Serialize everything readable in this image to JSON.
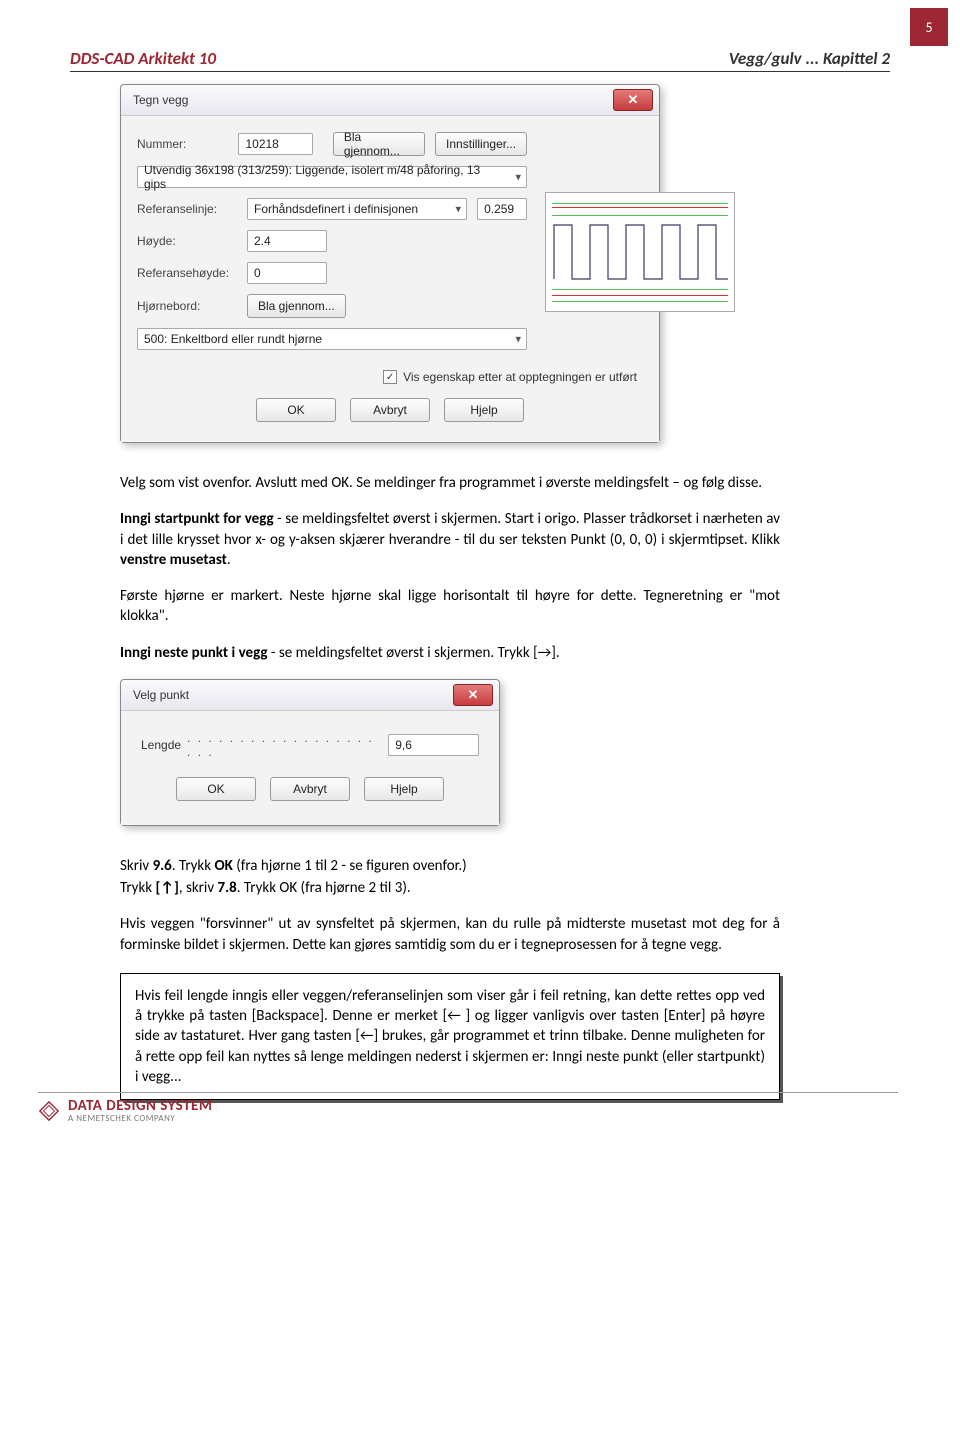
{
  "page_number": "5",
  "header": {
    "left": "DDS-CAD Arkitekt 10",
    "right": "Vegg/gulv ... Kapittel 2"
  },
  "dlg1": {
    "title": "Tegn vegg",
    "close": "✕",
    "nummer_label": "Nummer:",
    "nummer_value": "10218",
    "bla_gjennom": "Bla gjennom...",
    "innstillinger": "Innstillinger...",
    "type_value": "Utvendig 36x198 (313/259): Liggende, isolert m/48 påforing, 13 gips",
    "referanselinje_label": "Referanselinje:",
    "referanselinje_value": "Forhåndsdefinert i definisjonen",
    "referanselinje_num": "0.259",
    "hoyde_label": "Høyde:",
    "hoyde_value": "2.4",
    "refh_label": "Referansehøyde:",
    "refh_value": "0",
    "hjornebord_label": "Hjørnebord:",
    "hj_value": "500: Enkeltbord eller rundt hjørne",
    "check_label": "Vis egenskap etter at opptegningen er utført",
    "ok": "OK",
    "avbryt": "Avbryt",
    "hjelp": "Hjelp"
  },
  "p1": "Velg som vist ovenfor. Avslutt med OK. Se meldinger fra programmet i øverste meldingsfelt – og følg disse.",
  "p2a": "Inngi startpunkt for vegg",
  "p2b": " - se meldingsfeltet øverst i skjermen. Start i origo. Plasser trådkorset i nærheten av i det lille krysset hvor x- og y-aksen skjærer hverandre - til du ser teksten Punkt (0, 0, 0) i skjermtipset. Klikk ",
  "p2c": "venstre musetast",
  "p2d": ".",
  "p3": "Første hjørne er markert. Neste hjørne skal ligge horisontalt til høyre for dette. Tegneretning er \"mot klokka\".",
  "p4a": "Inngi neste punkt i vegg",
  "p4b": " - se meldingsfeltet øverst i skjermen. Trykk [→].",
  "dlg2": {
    "title": "Velg punkt",
    "close": "✕",
    "lengde_label": "Lengde",
    "dots": ". . . . . . . . . . . . . . . . . . . . .",
    "lengde_value": "9,6",
    "ok": "OK",
    "avbryt": "Avbryt",
    "hjelp": "Hjelp"
  },
  "p5a": "Skriv ",
  "p5b": "9.6",
  "p5c": ". Trykk ",
  "p5d": "OK",
  "p5e": "  (fra hjørne 1 til 2 - se figuren ovenfor.)",
  "p6a": "Trykk ",
  "p6b": "[↑]",
  "p6c": ", skriv ",
  "p6d": "7.8",
  "p6e": ". Trykk OK   (fra hjørne 2 til 3).",
  "p7": "Hvis veggen \"forsvinner\" ut av synsfeltet på skjermen, kan du rulle på midterste musetast mot deg for å forminske bildet i skjermen. Dette kan gjøres samtidig som du er i tegneprosessen for å tegne vegg.",
  "p8": "Hvis feil lengde inngis eller veggen/referanselinjen som viser går i feil retning, kan dette rettes opp ved å trykke på tasten [Backspace]. Denne er merket  [←    ] og ligger vanligvis over tasten [Enter] på høyre side av tastaturet. Hver gang tasten [←] brukes, går programmet et trinn tilbake. Denne muligheten for å rette opp feil kan nyttes så lenge meldingen nederst i skjermen er: Inngi neste punkt (eller startpunkt) i vegg...",
  "footer": {
    "brand": "DATA DESIGN SYSTEM",
    "sub": "A NEMETSCHEK COMPANY"
  }
}
